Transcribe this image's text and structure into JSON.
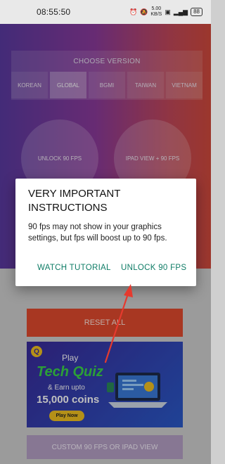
{
  "status_bar": {
    "time": "08:55:50",
    "net_speed": "5.00",
    "net_unit": "KB/S",
    "battery": "88"
  },
  "version_selector": {
    "title": "CHOOSE VERSION",
    "options": [
      "KOREAN",
      "GLOBAL",
      "BGMI",
      "TAIWAN",
      "VIETNAM"
    ],
    "selected": "GLOBAL"
  },
  "actions": {
    "unlock_90_fps": "UNLOCK 90 FPS",
    "ipad_view_90_fps": "IPAD VIEW + 90 FPS",
    "reset_all": "RESET ALL",
    "custom": "CUSTOM 90 FPS OR IPAD VIEW"
  },
  "ad_banner": {
    "play": "Play",
    "headline": "Tech Quiz",
    "earn": "& Earn upto",
    "coins": "15,000 coins",
    "cta": "Play Now"
  },
  "dialog": {
    "title": "VERY IMPORTANT INSTRUCTIONS",
    "body": "90 fps may not show in your graphics settings, but fps will boost up to 90 fps.",
    "buttons": {
      "watch_tutorial": "WATCH TUTORIAL",
      "unlock": "UNLOCK 90 FPS"
    }
  },
  "colors": {
    "accent_button_text": "#0e7c66",
    "annotation_arrow": "#e63a2e",
    "reset_button": "#e04a2e"
  }
}
